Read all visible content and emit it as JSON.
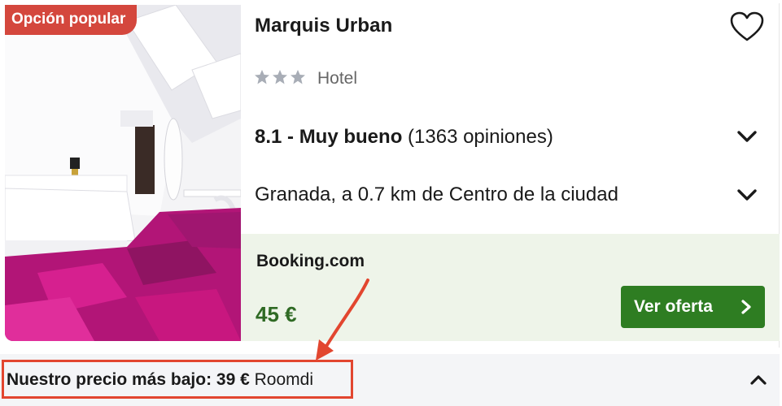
{
  "badge": {
    "label": "Opción popular"
  },
  "hotel": {
    "name": "Marquis Urban",
    "star_count": 3,
    "type": "Hotel",
    "rating_score": "8.1 - Muy bueno",
    "rating_count": "(1363 opiniones)",
    "location": "Granada, a 0.7 km de Centro de la ciudad"
  },
  "offer": {
    "provider": "Booking.com",
    "price": "45 €",
    "cta_label": "Ver oferta"
  },
  "lowest_price": {
    "label": "Nuestro precio más bajo: 39 €",
    "provider": "Roomdi"
  },
  "icons": {
    "favorite": "heart-icon",
    "expand_rating": "chevron-down-icon",
    "expand_location": "chevron-down-icon",
    "cta_arrow": "chevron-right-icon",
    "collapse": "chevron-up-icon"
  },
  "colors": {
    "badge": "#d4473d",
    "price": "#2f6a24",
    "cta": "#2e7d22",
    "offer_bg": "#eef4e9",
    "annotation": "#e2462f"
  }
}
